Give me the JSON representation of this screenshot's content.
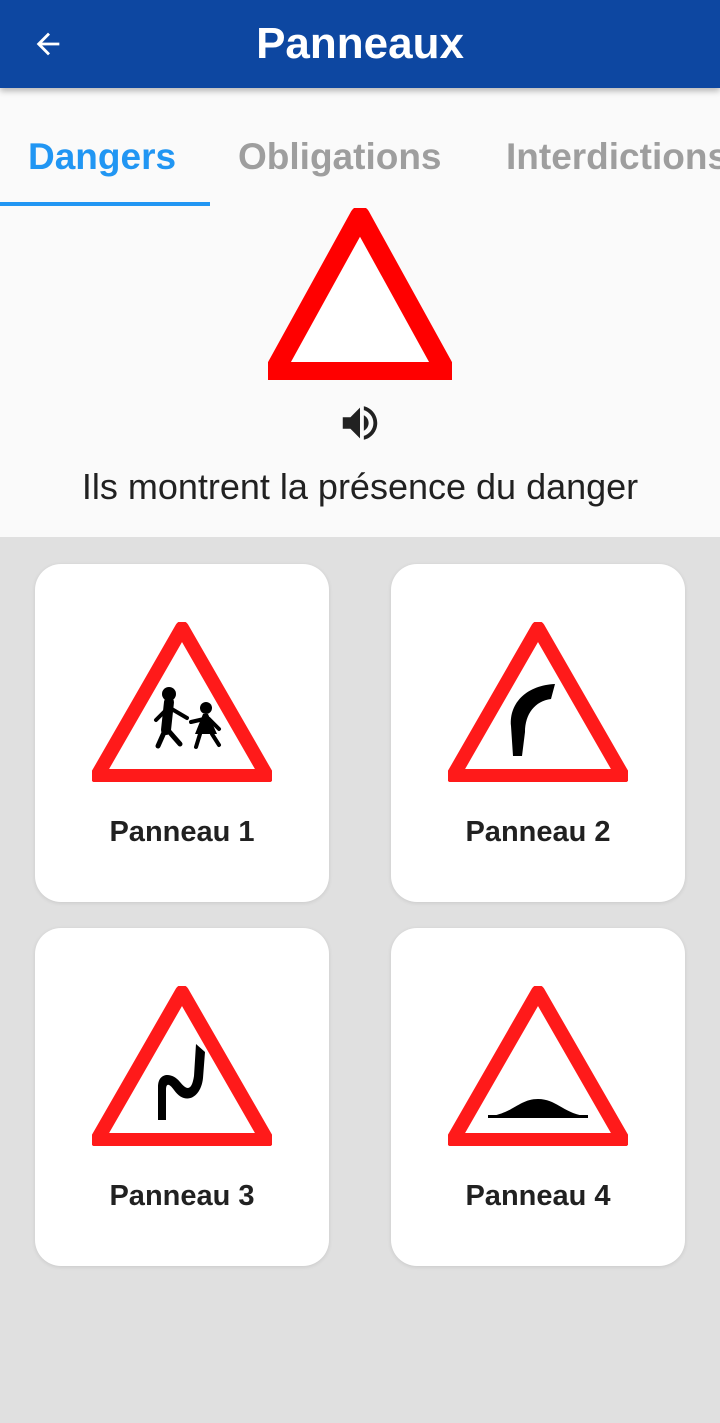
{
  "app_bar": {
    "title": "Panneaux",
    "back_icon": "arrow-left-icon",
    "background": "#0d47a1"
  },
  "tabs": [
    {
      "label": "Dangers",
      "active": true
    },
    {
      "label": "Obligations",
      "active": false
    },
    {
      "label": "Interdictions",
      "active": false
    }
  ],
  "category": {
    "icon": "danger-triangle-icon",
    "speaker_icon": "volume-up-icon",
    "description": "Ils montrent la présence du danger"
  },
  "signs": [
    {
      "label": "Panneau 1",
      "icon": "children-crossing-sign-icon"
    },
    {
      "label": "Panneau 2",
      "icon": "right-bend-sign-icon"
    },
    {
      "label": "Panneau 3",
      "icon": "double-bend-sign-icon"
    },
    {
      "label": "Panneau 4",
      "icon": "speed-bump-sign-icon"
    }
  ],
  "colors": {
    "accent": "#2196f3",
    "sign_red": "#ff0000",
    "inactive_tab": "#9e9e9e"
  }
}
